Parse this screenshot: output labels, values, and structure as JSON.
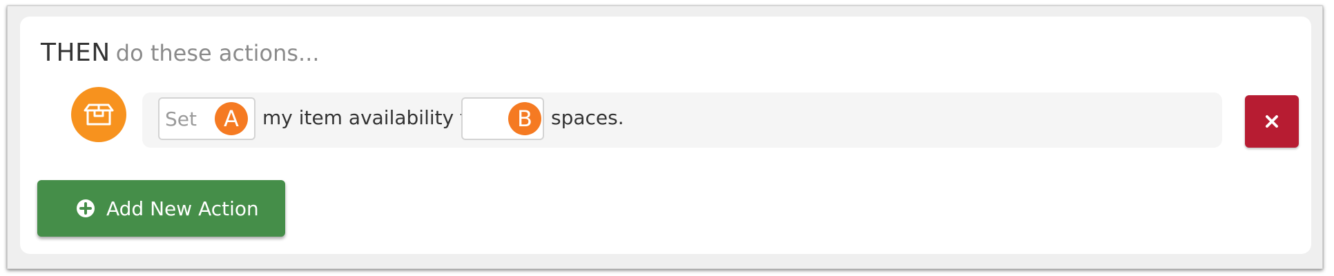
{
  "section": {
    "title": "THEN",
    "subtitle": "do these actions..."
  },
  "action": {
    "icon": "box-icon",
    "field_a": {
      "placeholder": "Set",
      "marker": "A"
    },
    "text_middle": "my item availability to",
    "field_b": {
      "placeholder": "",
      "marker": "B"
    },
    "text_end": "spaces.",
    "delete_icon": "close-icon"
  },
  "add_button": {
    "label": "Add New Action",
    "icon": "plus-circle-icon"
  },
  "colors": {
    "accent_orange": "#f7921e",
    "marker_orange": "#f57a22",
    "delete_red": "#b71c32",
    "add_green": "#458e49"
  }
}
